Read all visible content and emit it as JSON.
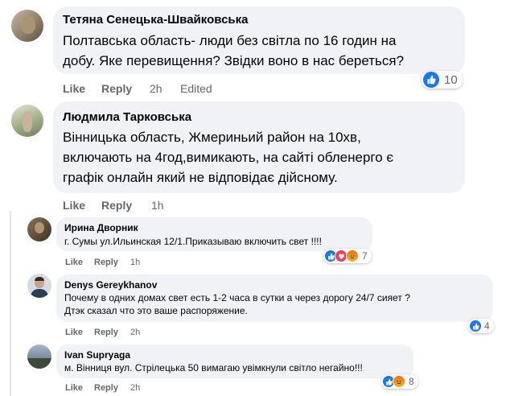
{
  "comments": [
    {
      "author": "Тетяна Сенецька-Швайковська",
      "lines": [
        "Полтавська область- люди без світла по 16 годин на",
        "добу. Яке перевищення? Звідки воно в нас береться?"
      ],
      "like": "Like",
      "reply": "Reply",
      "time": "2h",
      "edited": "Edited",
      "reactions": {
        "icons": [
          "like-icon"
        ],
        "count": "10"
      }
    },
    {
      "author": "Людмила Тарковська",
      "lines": [
        "Вінницька область, Жмериньий район на 10хв,",
        "включають на 4год,вимикають, на сайті обленерго є",
        "графік онлайн який не відповідає дійсному."
      ],
      "like": "Like",
      "reply": "Reply",
      "time": "1h"
    }
  ],
  "replies": [
    {
      "author": "Ирина Дворник",
      "lines": [
        "г. Сумы ул.Ильинская 12/1.Приказываю включить свет !!!!"
      ],
      "like": "Like",
      "reply": "Reply",
      "time": "1h",
      "reactions": {
        "icons": [
          "like-icon",
          "heart-icon",
          "angry-icon"
        ],
        "count": "7"
      }
    },
    {
      "author": "Denys Gereykhanov",
      "lines": [
        "Почему в одних домах свет есть 1-2 часа в сутки а через дорогу 24/7 сияет ?",
        "Дтэк сказал что это ваше распоряжение."
      ],
      "like": "Like",
      "reply": "Reply",
      "time": "2h",
      "reactions": {
        "icons": [
          "like-icon"
        ],
        "count": "4"
      }
    },
    {
      "author": "Ivan Supryaga",
      "lines": [
        "м. Вінниця вул. Стрілецька 50 вимагаю увімкнули світло негайно!!!"
      ],
      "like": "Like",
      "reply": "Reply",
      "time": "2h",
      "reactions": {
        "icons": [
          "like-icon",
          "angry-icon"
        ],
        "count": "8"
      }
    }
  ],
  "colors": {
    "bubble": "#f0f2f5",
    "meta": "#65676b",
    "like_blue": "#1877f2",
    "heart_red": "#f33e58",
    "angry": "#e9710f"
  }
}
